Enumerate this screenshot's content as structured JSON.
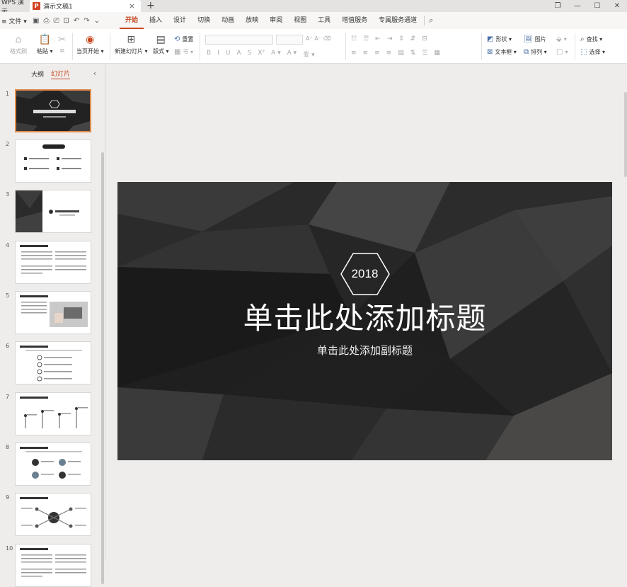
{
  "titlebar": {
    "app_name": "WPS 演示",
    "doc_icon": "P",
    "doc_title": "演示文稿1",
    "close_glyph": "×",
    "new_tab_glyph": "+",
    "win_restore": "❐",
    "win_minimize": "—",
    "win_maximize": "☐",
    "win_close": "✕"
  },
  "menubar": {
    "file_label": "≡ 文件 ▾",
    "tabs": [
      "开始",
      "插入",
      "设计",
      "切换",
      "动画",
      "放映",
      "审阅",
      "视图",
      "工具",
      "增值服务",
      "专属服务通道"
    ],
    "active_tab": "开始",
    "search_icon": "⌕"
  },
  "ribbon": {
    "format_painter": "格式刷",
    "paste": "粘贴 ▾",
    "cut_copy": "⧉",
    "from_current": "当页开始 ▾",
    "new_slide": "新建幻灯片 ▾",
    "layout": "版式 ▾",
    "section": "节 ▾",
    "reset": "重置",
    "font_format": [
      "B",
      "I",
      "U",
      "A",
      "S",
      "X²",
      "A ▾",
      "A ▾",
      "变 ▾"
    ],
    "para_format": [
      "≡",
      "≡",
      "≡",
      "≡",
      "▤",
      "⇅",
      "☰",
      "▦"
    ],
    "shape": "形状 ▾",
    "picture": "图片",
    "textbox": "文本框 ▾",
    "arrange": "排列 ▾",
    "find": "查找 ▾",
    "select": "选择 ▾"
  },
  "leftpanel": {
    "tab_outline": "大纲",
    "tab_slides": "幻灯片",
    "collapse_icon": "‹",
    "slide_numbers": [
      "1",
      "2",
      "3",
      "4",
      "5",
      "6",
      "7",
      "8",
      "9",
      "10"
    ],
    "selected_index": 1
  },
  "slide": {
    "year": "2018",
    "title": "单击此处添加标题",
    "subtitle": "单击此处添加副标题"
  },
  "colors": {
    "accent": "#c8481f",
    "slide_bg": "#1c1c1c",
    "selected_thumb_border": "#e08a4a"
  }
}
